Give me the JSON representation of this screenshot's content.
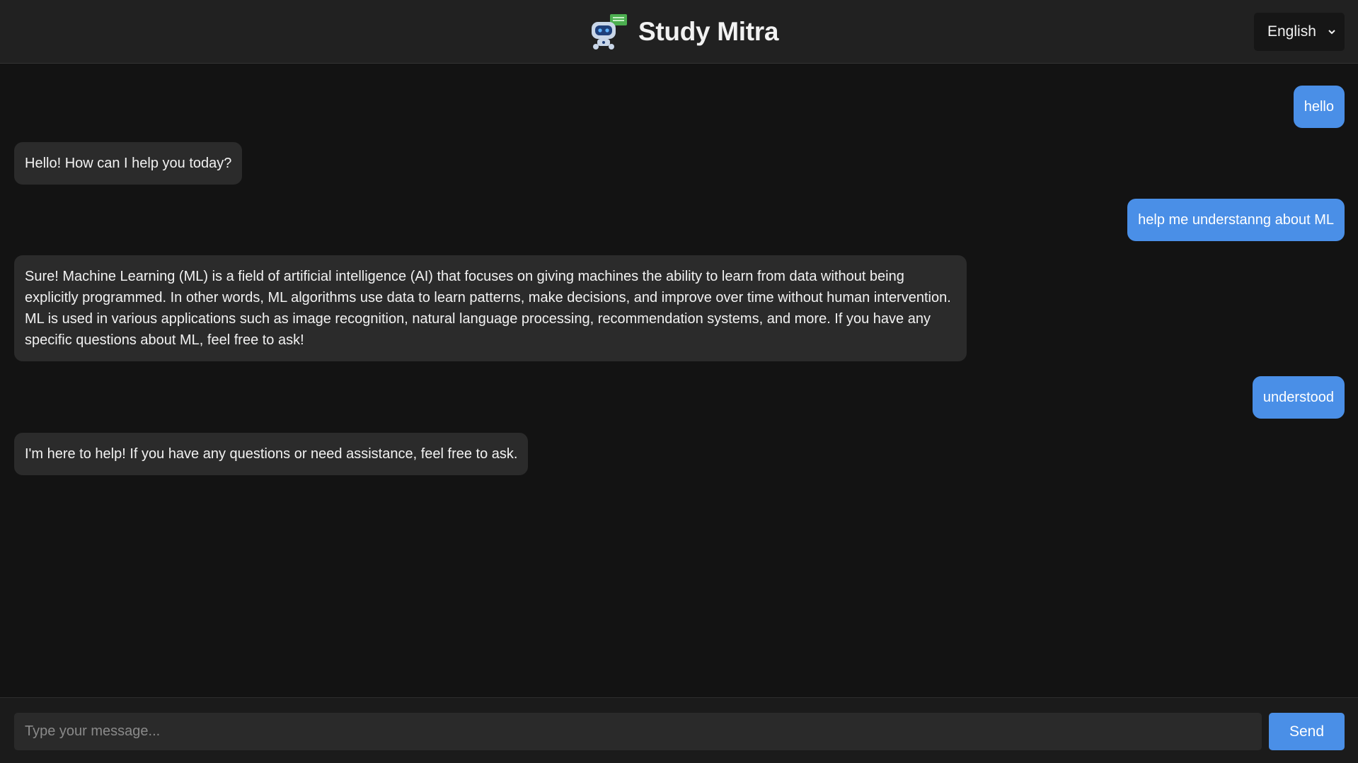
{
  "header": {
    "title": "Study Mitra",
    "logo_icon": "robot-chat-icon",
    "language": {
      "selected": "English"
    }
  },
  "messages": [
    {
      "role": "user",
      "text": "hello"
    },
    {
      "role": "bot",
      "text": "Hello! How can I help you today?"
    },
    {
      "role": "user",
      "text": "help me understanng about ML"
    },
    {
      "role": "bot",
      "text": "Sure! Machine Learning (ML) is a field of artificial intelligence (AI) that focuses on giving machines the ability to learn from data without being explicitly programmed. In other words, ML algorithms use data to learn patterns, make decisions, and improve over time without human intervention. ML is used in various applications such as image recognition, natural language processing, recommendation systems, and more. If you have any specific questions about ML, feel free to ask!"
    },
    {
      "role": "user",
      "text": "understood"
    },
    {
      "role": "bot",
      "text": "I'm here to help! If you have any questions or need assistance, feel free to ask."
    }
  ],
  "composer": {
    "placeholder": "Type your message...",
    "value": "",
    "send_label": "Send"
  },
  "colors": {
    "accent": "#4a8fe7",
    "background": "#131313",
    "header": "#212121",
    "bot_bubble": "#2b2b2b"
  }
}
